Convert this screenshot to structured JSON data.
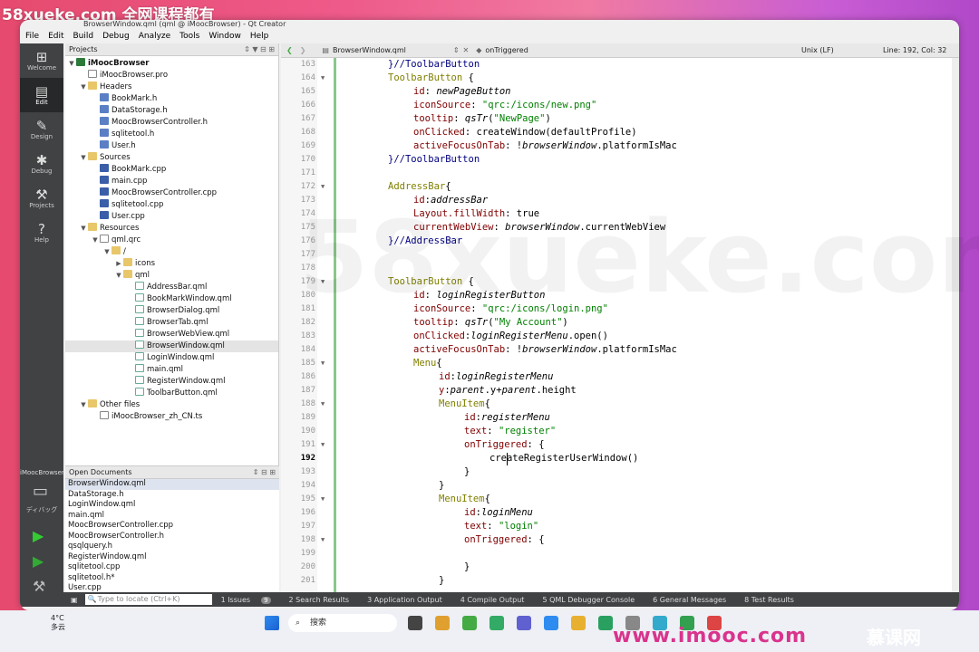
{
  "watermark_top": "58xueke.com 全网课程都有",
  "window_title": "BrowserWindow.qml (qml @ iMoocBrowser) - Qt Creator",
  "menu": [
    "File",
    "Edit",
    "Build",
    "Debug",
    "Analyze",
    "Tools",
    "Window",
    "Help"
  ],
  "modes": [
    {
      "label": "Welcome",
      "icon": "grid-icon"
    },
    {
      "label": "Edit",
      "icon": "edit-icon"
    },
    {
      "label": "Design",
      "icon": "pencil-icon"
    },
    {
      "label": "Debug",
      "icon": "bug-icon"
    },
    {
      "label": "Projects",
      "icon": "wrench-icon"
    },
    {
      "label": "Help",
      "icon": "help-icon"
    }
  ],
  "mode_bottom": {
    "kit_label": "iMoocBrowser",
    "debug_label": "ディバッグ"
  },
  "projects_panel_title": "Projects",
  "tree": [
    {
      "label": "iMoocBrowser",
      "level": 0,
      "type": "proj",
      "expanded": true,
      "bold": true
    },
    {
      "label": "iMoocBrowser.pro",
      "level": 1,
      "type": "file"
    },
    {
      "label": "Headers",
      "level": 1,
      "type": "folder",
      "expanded": true
    },
    {
      "label": "BookMark.h",
      "level": 2,
      "type": "h"
    },
    {
      "label": "DataStorage.h",
      "level": 2,
      "type": "h"
    },
    {
      "label": "MoocBrowserController.h",
      "level": 2,
      "type": "h"
    },
    {
      "label": "sqlitetool.h",
      "level": 2,
      "type": "h"
    },
    {
      "label": "User.h",
      "level": 2,
      "type": "h"
    },
    {
      "label": "Sources",
      "level": 1,
      "type": "folder",
      "expanded": true
    },
    {
      "label": "BookMark.cpp",
      "level": 2,
      "type": "cpp"
    },
    {
      "label": "main.cpp",
      "level": 2,
      "type": "cpp"
    },
    {
      "label": "MoocBrowserController.cpp",
      "level": 2,
      "type": "cpp"
    },
    {
      "label": "sqlitetool.cpp",
      "level": 2,
      "type": "cpp"
    },
    {
      "label": "User.cpp",
      "level": 2,
      "type": "cpp"
    },
    {
      "label": "Resources",
      "level": 1,
      "type": "folder",
      "expanded": true
    },
    {
      "label": "qml.qrc",
      "level": 2,
      "type": "file",
      "expanded": true
    },
    {
      "label": "/",
      "level": 3,
      "type": "folder",
      "expanded": true
    },
    {
      "label": "icons",
      "level": 4,
      "type": "folder",
      "expanded": false
    },
    {
      "label": "qml",
      "level": 4,
      "type": "folder",
      "expanded": true
    },
    {
      "label": "AddressBar.qml",
      "level": 5,
      "type": "qml"
    },
    {
      "label": "BookMarkWindow.qml",
      "level": 5,
      "type": "qml"
    },
    {
      "label": "BrowserDialog.qml",
      "level": 5,
      "type": "qml"
    },
    {
      "label": "BrowserTab.qml",
      "level": 5,
      "type": "qml"
    },
    {
      "label": "BrowserWebView.qml",
      "level": 5,
      "type": "qml"
    },
    {
      "label": "BrowserWindow.qml",
      "level": 5,
      "type": "qml",
      "selected": true
    },
    {
      "label": "LoginWindow.qml",
      "level": 5,
      "type": "qml"
    },
    {
      "label": "main.qml",
      "level": 5,
      "type": "qml"
    },
    {
      "label": "RegisterWindow.qml",
      "level": 5,
      "type": "qml"
    },
    {
      "label": "ToolbarButton.qml",
      "level": 5,
      "type": "qml"
    },
    {
      "label": "Other files",
      "level": 1,
      "type": "folder",
      "expanded": true
    },
    {
      "label": "iMoocBrowser_zh_CN.ts",
      "level": 2,
      "type": "file"
    }
  ],
  "open_docs_title": "Open Documents",
  "open_docs": [
    "BrowserWindow.qml",
    "DataStorage.h",
    "LoginWindow.qml",
    "main.qml",
    "MoocBrowserController.cpp",
    "MoocBrowserController.h",
    "qsqlquery.h",
    "RegisterWindow.qml",
    "sqlitetool.cpp",
    "sqlitetool.h*",
    "User.cpp"
  ],
  "editor_tab": "BrowserWindow.qml",
  "symbol": "onTriggered",
  "line_ending": "Unix (LF)",
  "cursor_pos": "Line: 192, Col: 32",
  "current_line": 192,
  "code_lines": [
    {
      "n": 163,
      "indent": 2,
      "t": [
        [
          "cm",
          "}//ToolbarButton"
        ]
      ]
    },
    {
      "n": 164,
      "indent": 2,
      "fold": true,
      "t": [
        [
          "kw",
          "ToolbarButton"
        ],
        [
          "pl",
          " {"
        ]
      ]
    },
    {
      "n": 165,
      "indent": 3,
      "t": [
        [
          "prop",
          "id"
        ],
        [
          "pl",
          ": "
        ],
        [
          "it",
          "newPageButton"
        ]
      ]
    },
    {
      "n": 166,
      "indent": 3,
      "t": [
        [
          "prop",
          "iconSource"
        ],
        [
          "pl",
          ": "
        ],
        [
          "str",
          "\"qrc:/icons/new.png\""
        ]
      ]
    },
    {
      "n": 167,
      "indent": 3,
      "t": [
        [
          "prop",
          "tooltip"
        ],
        [
          "pl",
          ": "
        ],
        [
          "it",
          "qsTr"
        ],
        [
          "pl",
          "("
        ],
        [
          "str",
          "\"NewPage\""
        ],
        [
          "pl",
          ")"
        ]
      ]
    },
    {
      "n": 168,
      "indent": 3,
      "t": [
        [
          "prop",
          "onClicked"
        ],
        [
          "pl",
          ": createWindow(defaultProfile)"
        ]
      ]
    },
    {
      "n": 169,
      "indent": 3,
      "t": [
        [
          "prop",
          "activeFocusOnTab"
        ],
        [
          "pl",
          ": !"
        ],
        [
          "it",
          "browserWindow"
        ],
        [
          "pl",
          ".platformIsMac"
        ]
      ]
    },
    {
      "n": 170,
      "indent": 2,
      "t": [
        [
          "cm",
          "}//ToolbarButton"
        ]
      ]
    },
    {
      "n": 171,
      "indent": 0,
      "t": []
    },
    {
      "n": 172,
      "indent": 2,
      "fold": true,
      "t": [
        [
          "kw",
          "AddressBar"
        ],
        [
          "pl",
          "{"
        ]
      ]
    },
    {
      "n": 173,
      "indent": 3,
      "t": [
        [
          "prop",
          "id"
        ],
        [
          "pl",
          ":"
        ],
        [
          "it",
          "addressBar"
        ]
      ]
    },
    {
      "n": 174,
      "indent": 3,
      "t": [
        [
          "prop",
          "Layout.fillWidth"
        ],
        [
          "pl",
          ": true"
        ]
      ]
    },
    {
      "n": 175,
      "indent": 3,
      "t": [
        [
          "prop",
          "currentWebView"
        ],
        [
          "pl",
          ": "
        ],
        [
          "it",
          "browserWindow"
        ],
        [
          "pl",
          ".currentWebView"
        ]
      ]
    },
    {
      "n": 176,
      "indent": 2,
      "t": [
        [
          "cm",
          "}//AddressBar"
        ]
      ]
    },
    {
      "n": 177,
      "indent": 0,
      "t": []
    },
    {
      "n": 178,
      "indent": 0,
      "t": []
    },
    {
      "n": 179,
      "indent": 2,
      "fold": true,
      "t": [
        [
          "kw",
          "ToolbarButton"
        ],
        [
          "pl",
          " {"
        ]
      ]
    },
    {
      "n": 180,
      "indent": 3,
      "t": [
        [
          "prop",
          "id"
        ],
        [
          "pl",
          ": "
        ],
        [
          "it",
          "loginRegisterButton"
        ]
      ]
    },
    {
      "n": 181,
      "indent": 3,
      "t": [
        [
          "prop",
          "iconSource"
        ],
        [
          "pl",
          ": "
        ],
        [
          "str",
          "\"qrc:/icons/login.png\""
        ]
      ]
    },
    {
      "n": 182,
      "indent": 3,
      "t": [
        [
          "prop",
          "tooltip"
        ],
        [
          "pl",
          ": "
        ],
        [
          "it",
          "qsTr"
        ],
        [
          "pl",
          "("
        ],
        [
          "str",
          "\"My Account\""
        ],
        [
          "pl",
          ")"
        ]
      ]
    },
    {
      "n": 183,
      "indent": 3,
      "t": [
        [
          "prop",
          "onClicked"
        ],
        [
          "pl",
          ":"
        ],
        [
          "it",
          "loginRegisterMenu"
        ],
        [
          "pl",
          ".open()"
        ]
      ]
    },
    {
      "n": 184,
      "indent": 3,
      "t": [
        [
          "prop",
          "activeFocusOnTab"
        ],
        [
          "pl",
          ": !"
        ],
        [
          "it",
          "browserWindow"
        ],
        [
          "pl",
          ".platformIsMac"
        ]
      ]
    },
    {
      "n": 185,
      "indent": 3,
      "fold": true,
      "t": [
        [
          "kw",
          "Menu"
        ],
        [
          "pl",
          "{"
        ]
      ]
    },
    {
      "n": 186,
      "indent": 4,
      "t": [
        [
          "prop",
          "id"
        ],
        [
          "pl",
          ":"
        ],
        [
          "it",
          "loginRegisterMenu"
        ]
      ]
    },
    {
      "n": 187,
      "indent": 4,
      "t": [
        [
          "prop",
          "y"
        ],
        [
          "pl",
          ":"
        ],
        [
          "it",
          "parent"
        ],
        [
          "pl",
          ".y+"
        ],
        [
          "it",
          "parent"
        ],
        [
          "pl",
          ".height"
        ]
      ]
    },
    {
      "n": 188,
      "indent": 4,
      "fold": true,
      "t": [
        [
          "kw",
          "MenuItem"
        ],
        [
          "pl",
          "{"
        ]
      ]
    },
    {
      "n": 189,
      "indent": 5,
      "t": [
        [
          "prop",
          "id"
        ],
        [
          "pl",
          ":"
        ],
        [
          "it",
          "registerMenu"
        ]
      ]
    },
    {
      "n": 190,
      "indent": 5,
      "t": [
        [
          "prop",
          "text"
        ],
        [
          "pl",
          ": "
        ],
        [
          "str",
          "\"register\""
        ]
      ]
    },
    {
      "n": 191,
      "indent": 5,
      "fold": true,
      "t": [
        [
          "prop",
          "onTriggered"
        ],
        [
          "pl",
          ": {"
        ]
      ]
    },
    {
      "n": 192,
      "indent": 6,
      "t": [
        [
          "pl",
          "createRegisterUserWindow()"
        ]
      ]
    },
    {
      "n": 193,
      "indent": 5,
      "t": [
        [
          "pl",
          "}"
        ]
      ]
    },
    {
      "n": 194,
      "indent": 4,
      "t": [
        [
          "pl",
          "}"
        ]
      ]
    },
    {
      "n": 195,
      "indent": 4,
      "fold": true,
      "t": [
        [
          "kw",
          "MenuItem"
        ],
        [
          "pl",
          "{"
        ]
      ]
    },
    {
      "n": 196,
      "indent": 5,
      "t": [
        [
          "prop",
          "id"
        ],
        [
          "pl",
          ":"
        ],
        [
          "it",
          "loginMenu"
        ]
      ]
    },
    {
      "n": 197,
      "indent": 5,
      "t": [
        [
          "prop",
          "text"
        ],
        [
          "pl",
          ": "
        ],
        [
          "str",
          "\"login\""
        ]
      ]
    },
    {
      "n": 198,
      "indent": 5,
      "fold": true,
      "t": [
        [
          "prop",
          "onTriggered"
        ],
        [
          "pl",
          ": {"
        ]
      ]
    },
    {
      "n": 199,
      "indent": 0,
      "t": []
    },
    {
      "n": 200,
      "indent": 5,
      "t": [
        [
          "pl",
          "}"
        ]
      ]
    },
    {
      "n": 201,
      "indent": 4,
      "t": [
        [
          "pl",
          "}"
        ]
      ]
    }
  ],
  "bottom": {
    "locate_placeholder": "Type to locate (Ctrl+K)",
    "tabs": [
      "1 Issues",
      "2 Search Results",
      "3 Application Output",
      "4 Compile Output",
      "5 QML Debugger Console",
      "6 General Messages",
      "8 Test Results"
    ],
    "issues_count": "9"
  },
  "taskbar": {
    "weather_temp": "4°C",
    "weather_text": "多云",
    "search": "搜索"
  },
  "watermark_bottom": "www.imooc.com",
  "watermark_brand": "慕课网",
  "bg_watermark": "58xueke.com",
  "colors": {
    "keyword": "#808000",
    "property": "#800000",
    "string": "#008000",
    "comment": "#000080",
    "mode_bar": "#404244"
  }
}
